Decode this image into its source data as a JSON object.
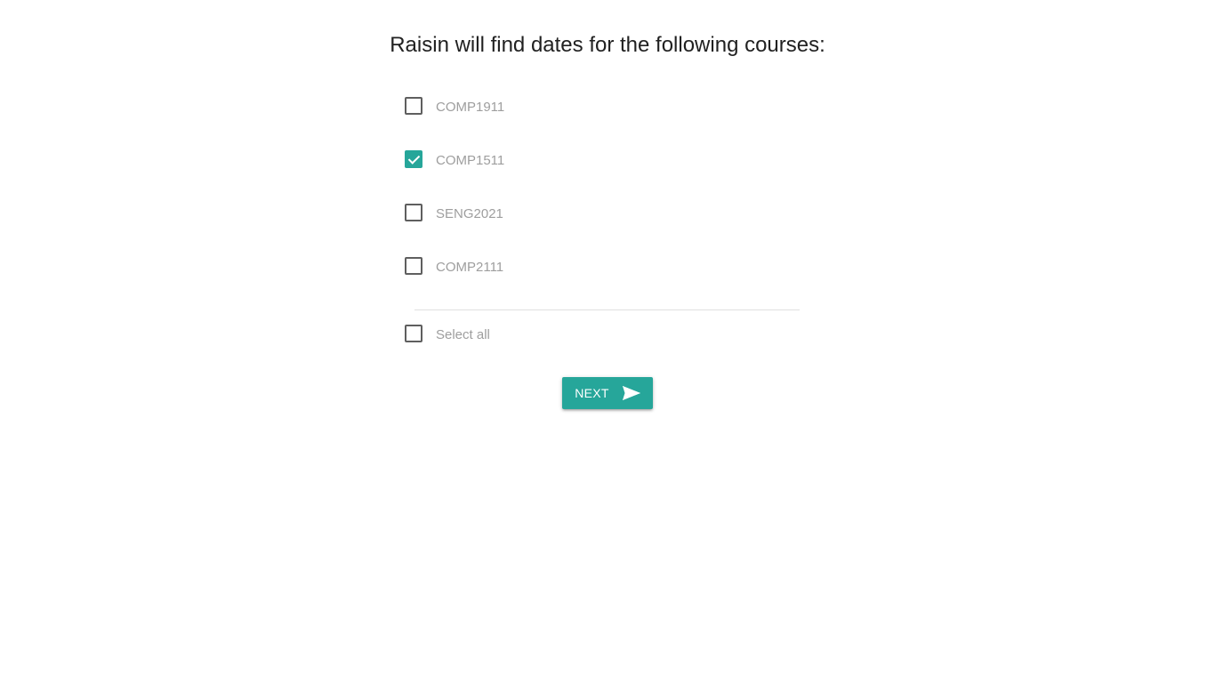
{
  "heading": "Raisin will find dates for the following courses:",
  "courses": [
    {
      "code": "COMP1911",
      "checked": false
    },
    {
      "code": "COMP1511",
      "checked": true
    },
    {
      "code": "SENG2021",
      "checked": false
    },
    {
      "code": "COMP2111",
      "checked": false
    }
  ],
  "select_all": {
    "label": "Select all",
    "checked": false
  },
  "next_button": {
    "label": "NEXT",
    "icon": "send-icon"
  },
  "colors": {
    "accent": "#26a69a",
    "label_text": "#9e9e9e",
    "heading_text": "#212121"
  }
}
